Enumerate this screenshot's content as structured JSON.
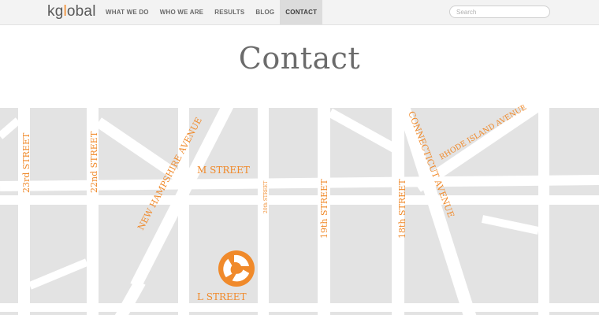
{
  "header": {
    "logo": {
      "left": "kg",
      "mid": "l",
      "right": "obal"
    },
    "nav": [
      {
        "label": "WHAT WE DO",
        "active": false
      },
      {
        "label": "WHO WE ARE",
        "active": false
      },
      {
        "label": "RESULTS",
        "active": false
      },
      {
        "label": "BLOG",
        "active": false
      },
      {
        "label": "CONTACT",
        "active": true
      }
    ],
    "search": {
      "placeholder": "Search",
      "value": ""
    }
  },
  "page": {
    "title": "Contact"
  },
  "map": {
    "streets": {
      "s23": "23rd STREET",
      "s22": "22nd STREET",
      "new_hampshire": "NEW HAMPSHIRE AVENUE",
      "m_street": "M STREET",
      "s20": "20th STREET",
      "s19": "19th STREET",
      "s18": "18th STREET",
      "connecticut": "CONNECTICUT AVENUE",
      "rhode_island": "RHODE ISLAND AVENUE",
      "l_street": "L STREET"
    },
    "marker_icon": "kglobal-marker-icon"
  },
  "colors": {
    "accent": "#f08a2b",
    "block": "#e3e3e3",
    "road": "#ffffff",
    "nav_bg": "#f3f3f3",
    "nav_active": "#dcdcdc",
    "title": "#6b6b6b"
  }
}
